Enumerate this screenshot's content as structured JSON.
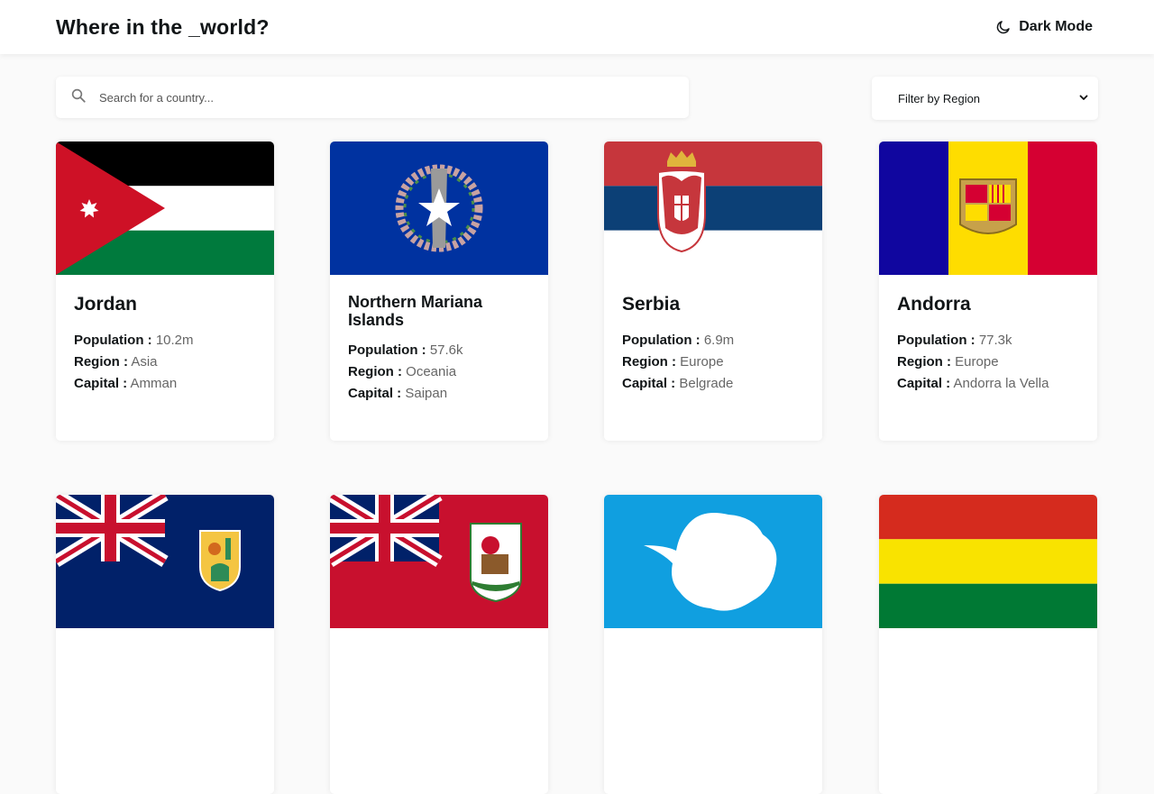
{
  "header": {
    "title": "Where in the _world?",
    "theme_toggle_label": "Dark Mode"
  },
  "search": {
    "placeholder": "Search for a country..."
  },
  "filter": {
    "label": "Filter by Region"
  },
  "labels": {
    "population": "Population :",
    "region": "Region :",
    "capital": "Capital :"
  },
  "countries": [
    {
      "name": "Jordan",
      "population": "10.2m",
      "region": "Asia",
      "capital": "Amman",
      "flag": "jordan-flag"
    },
    {
      "name": "Northern Mariana Islands",
      "population": "57.6k",
      "region": "Oceania",
      "capital": "Saipan",
      "flag": "northern-mariana-islands-flag"
    },
    {
      "name": "Serbia",
      "population": "6.9m",
      "region": "Europe",
      "capital": "Belgrade",
      "flag": "serbia-flag"
    },
    {
      "name": "Andorra",
      "population": "77.3k",
      "region": "Europe",
      "capital": "Andorra la Vella",
      "flag": "andorra-flag"
    },
    {
      "flag": "turks-and-caicos-flag"
    },
    {
      "flag": "bermuda-flag"
    },
    {
      "flag": "antarctica-flag"
    },
    {
      "flag": "bolivia-flag"
    }
  ],
  "colors": {
    "background": "#fafafa",
    "card": "#ffffff",
    "text": "#111517"
  }
}
